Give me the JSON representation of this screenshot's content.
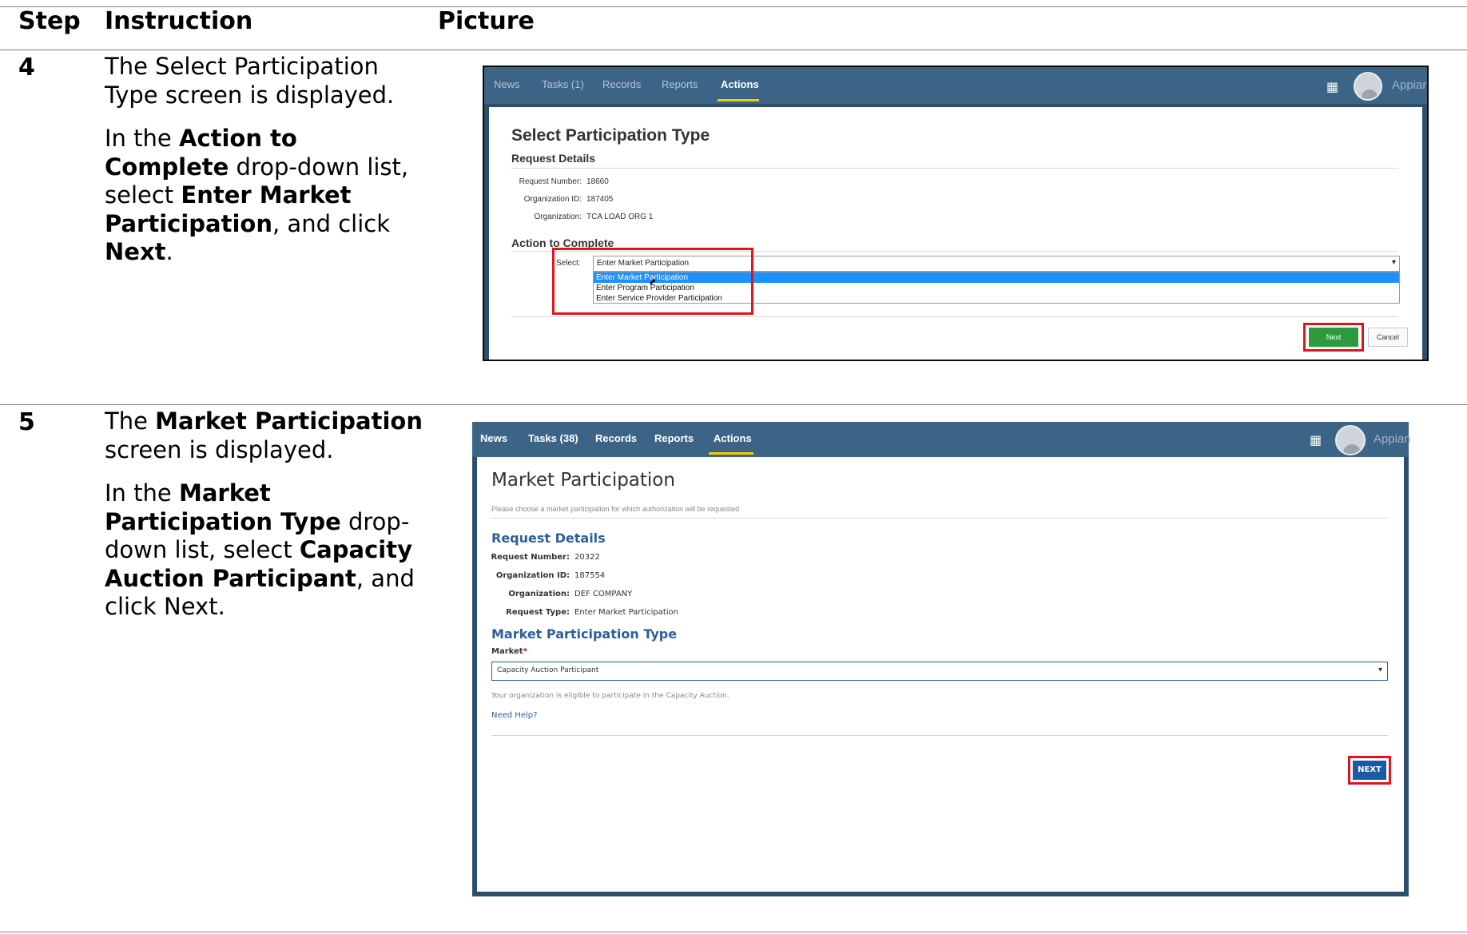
{
  "table": {
    "headers": {
      "step": "Step",
      "instruction": "Instruction",
      "picture": "Picture"
    }
  },
  "step4": {
    "number": "4",
    "para1": "The Select Participation Type screen is displayed.",
    "para2": {
      "t1": "In the ",
      "b1": "Action to Complete",
      "t2": " drop-down list, select ",
      "b2": "Enter Market Participation",
      "t3": ", and click ",
      "b3": "Next",
      "t4": "."
    },
    "screenshot": {
      "nav": {
        "news": "News",
        "tasks": "Tasks (1)",
        "records": "Records",
        "reports": "Reports",
        "actions": "Actions",
        "brand": "Appian"
      },
      "title": "Select Participation Type",
      "section1": "Request Details",
      "fields": [
        {
          "label": "Request Number:",
          "value": "18660"
        },
        {
          "label": "Organization ID:",
          "value": "187405"
        },
        {
          "label": "Organization:",
          "value": "TCA LOAD ORG 1"
        }
      ],
      "section2": "Action to Complete",
      "select_label": "Select:",
      "select_value": "Enter Market Participation",
      "options": [
        "Enter Market Participation",
        "Enter Program Participation",
        "Enter Service Provider Participation"
      ],
      "next_label": "Next",
      "cancel_label": "Cancel"
    }
  },
  "step5": {
    "number": "5",
    "para1": {
      "t1": "The ",
      "b1": "Market Participation",
      "t2": " screen is displayed."
    },
    "para2": {
      "t1": "In the ",
      "b1": "Market Participation Type",
      "t2": " drop-down list, select ",
      "b2": "Capacity Auction Participant",
      "t3": ", and click Next."
    },
    "screenshot": {
      "nav": {
        "news": "News",
        "tasks": "Tasks (38)",
        "records": "Records",
        "reports": "Reports",
        "actions": "Actions",
        "brand": "Appian"
      },
      "title": "Market Participation",
      "instructions": "Please choose a market participation for which authorization will be requested",
      "section1": "Request Details",
      "fields": [
        {
          "label": "Request Number:",
          "value": "20322"
        },
        {
          "label": "Organization ID:",
          "value": "187554"
        },
        {
          "label": "Organization:",
          "value": "DEF COMPANY"
        },
        {
          "label": "Request Type:",
          "value": "Enter Market Participation"
        }
      ],
      "section2": "Market Participation Type",
      "market_label": "Market",
      "required_mark": "*",
      "select_value": "Capacity Auction Participant",
      "note": "Your organization is eligible to participate in the Capacity Auction.",
      "help_link": "Need Help?",
      "next_label": "NEXT"
    }
  },
  "colors": {
    "nav_bg": "#3c6487",
    "frame_bg": "#2c4f6e",
    "accent_yellow": "#f0d000",
    "highlight_red": "#e0141c",
    "next_green": "#2e9a3e",
    "next_blue": "#1c5aa8",
    "section_blue": "#2c5f9a"
  }
}
